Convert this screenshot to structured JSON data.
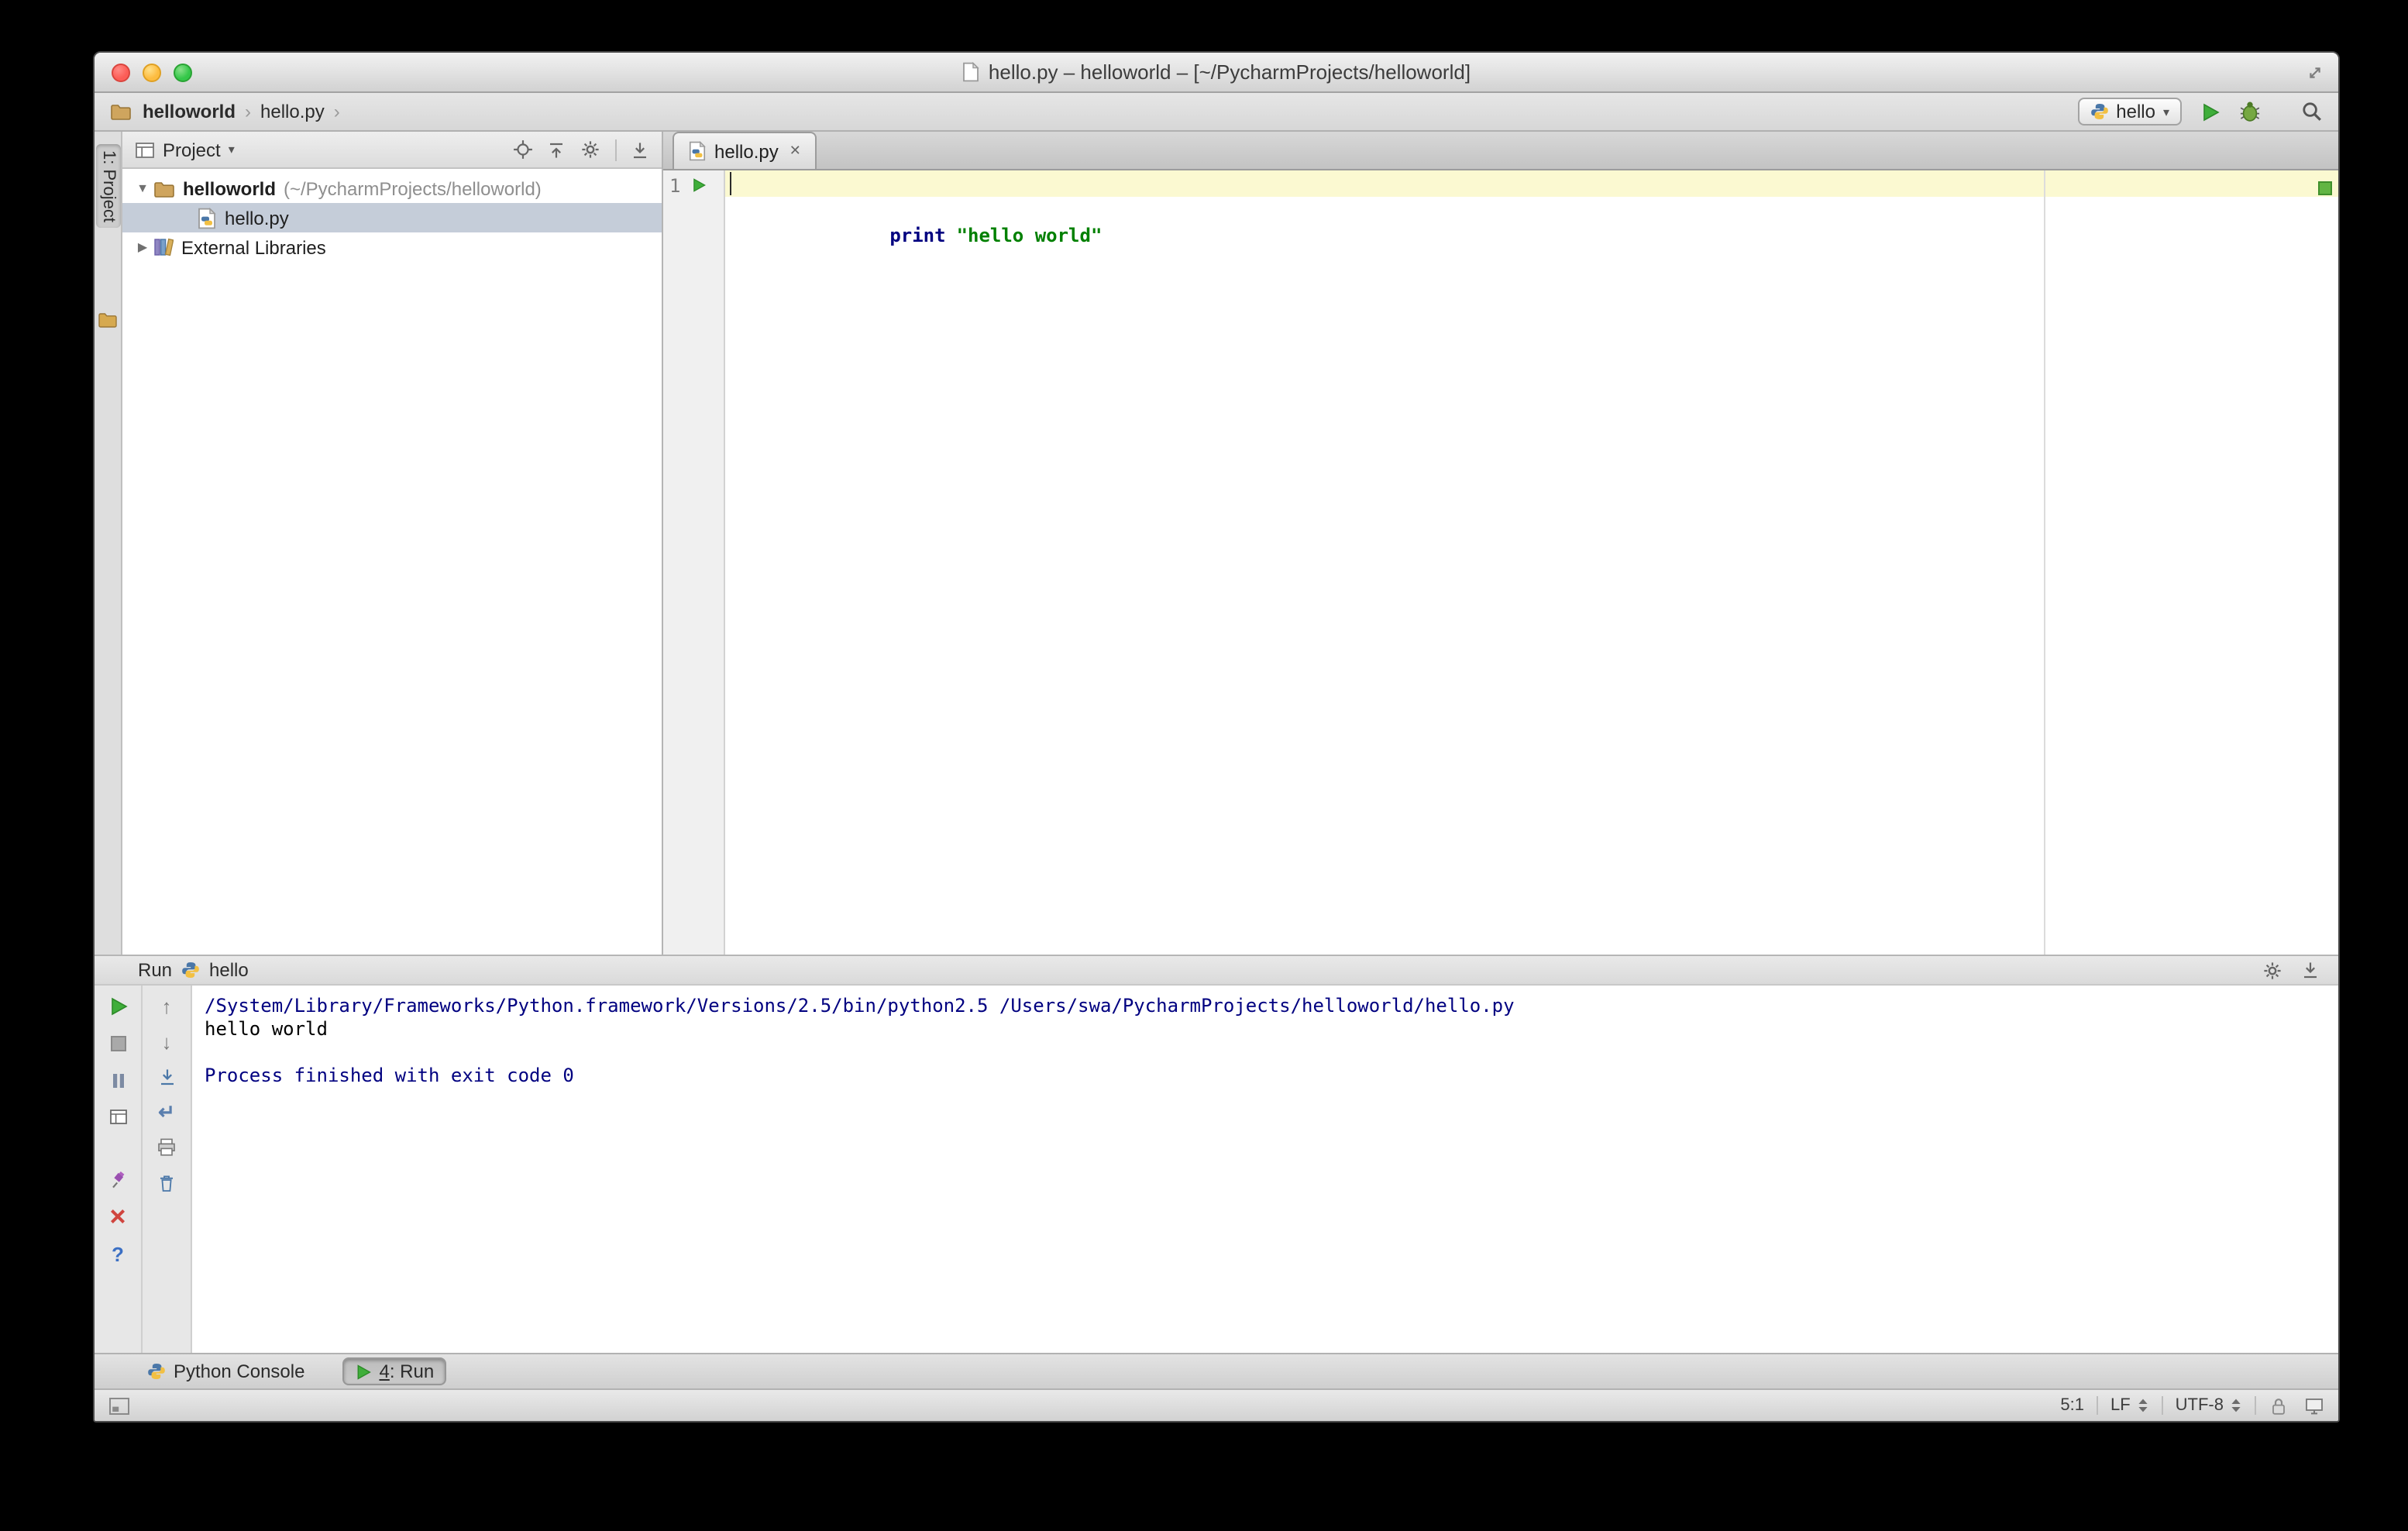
{
  "titlebar": {
    "title": "hello.py – helloworld – [~/PycharmProjects/helloworld]"
  },
  "navbar": {
    "breadcrumb": [
      "helloworld",
      "hello.py"
    ],
    "run_config": "hello"
  },
  "project_panel": {
    "strip_label": "1: Project",
    "header_label": "Project",
    "root_name": "helloworld",
    "root_path": "(~/PycharmProjects/helloworld)",
    "file_name": "hello.py",
    "external_libraries": "External Libraries"
  },
  "editor": {
    "tab_label": "hello.py",
    "line_number": "1",
    "keyword": "print",
    "string_literal": "\"hello world\""
  },
  "run_panel": {
    "label": "Run",
    "config_name": "hello",
    "console_command": "/System/Library/Frameworks/Python.framework/Versions/2.5/bin/python2.5 /Users/swa/PycharmProjects/helloworld/hello.py",
    "console_output": "hello world",
    "console_exit": "Process finished with exit code 0"
  },
  "toolwindow_bar": {
    "python_console_label": "Python Console",
    "run_tab_number": "4",
    "run_tab_suffix": ": Run"
  },
  "statusbar": {
    "caret_position": "5:1",
    "line_separator": "LF",
    "encoding": "UTF-8"
  },
  "icons": {
    "chevron": "›",
    "caret_down": "▾",
    "tree_expanded": "▼",
    "tree_collapsed": "▶",
    "close": "✕",
    "up_arrow": "↑",
    "down_arrow": "↓",
    "return_arrow": "↵",
    "help": "?"
  },
  "colors": {
    "keyword": "#000080",
    "string": "#008000",
    "console_info": "#000080",
    "run_green": "#3fae3a",
    "tree_selection": "#c5cdd9",
    "caret_row": "#fbf9d1"
  }
}
